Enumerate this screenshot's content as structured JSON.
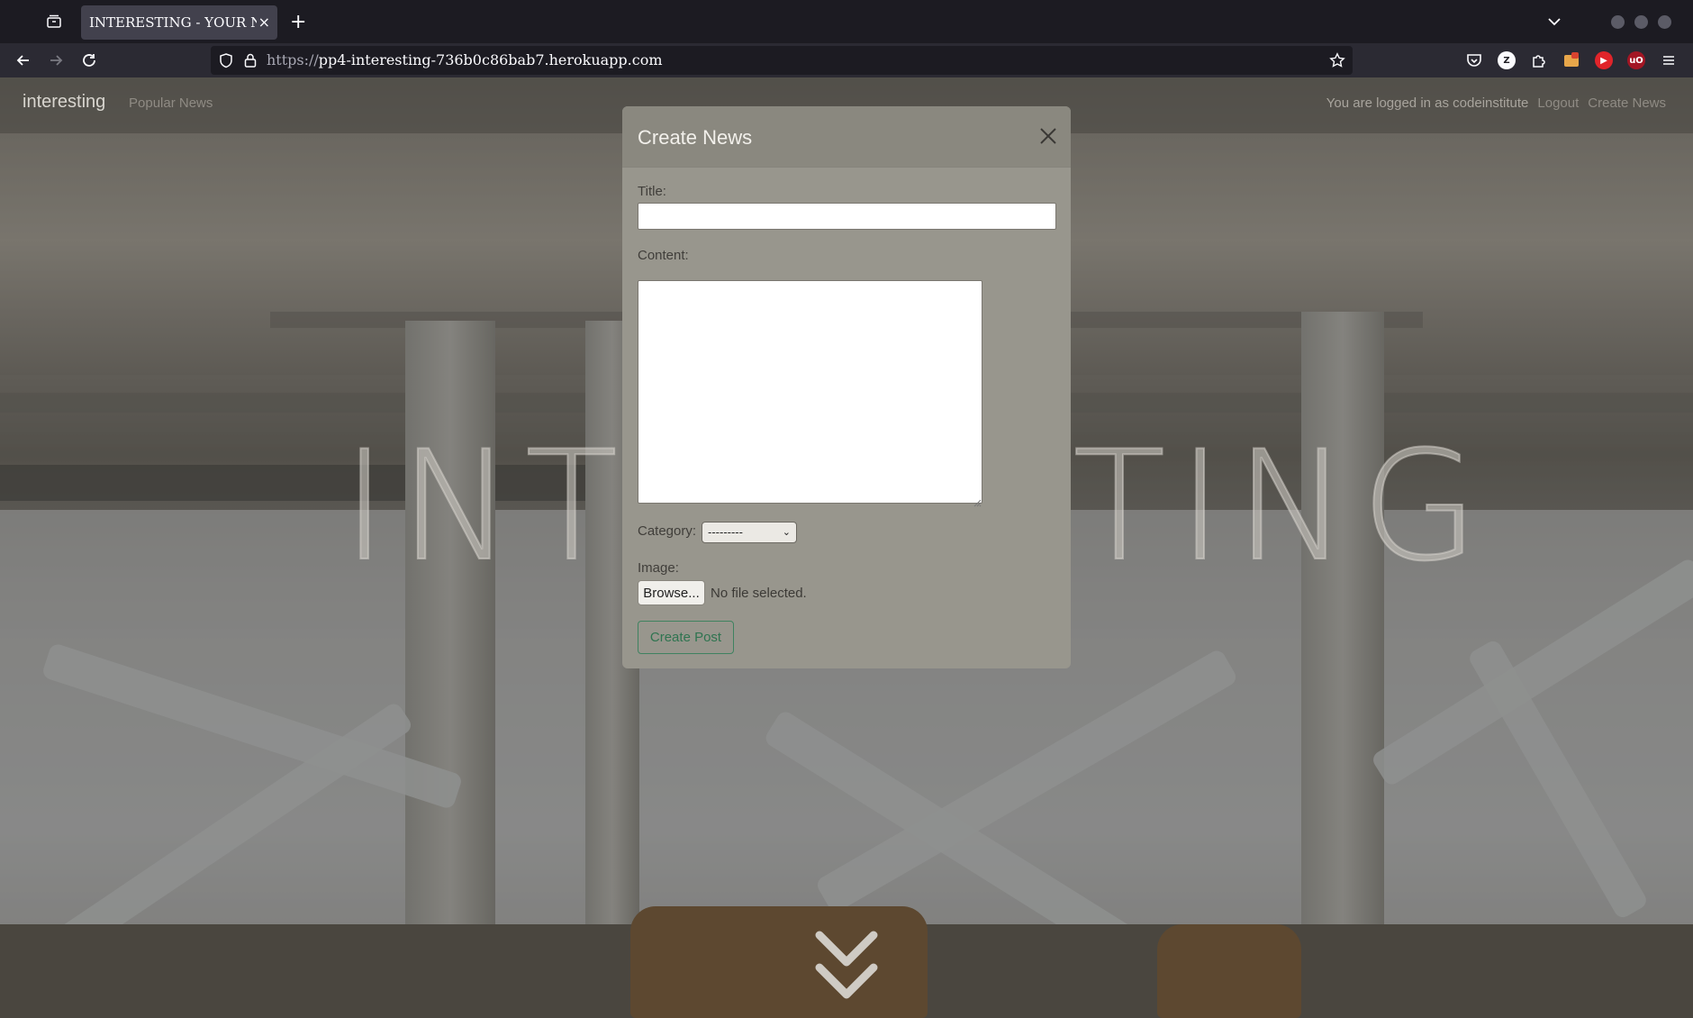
{
  "browser": {
    "tab_title": "INTERESTING - YOUR NEWS",
    "tab_close": "×",
    "new_tab": "+",
    "url_scheme": "https://",
    "url_host": "pp4-interesting-736b0c86bab7.herokuapp.com",
    "extensions": [
      {
        "name": "zotero",
        "glyph": "Z",
        "color": "#fbfbfe"
      },
      {
        "name": "youtube",
        "glyph": "▶",
        "color": "#e0242a"
      },
      {
        "name": "ublock",
        "glyph": "uO",
        "color": "#a31624"
      }
    ]
  },
  "site": {
    "brand": "interesting",
    "nav_popular": "Popular News",
    "logged_in_text": "You are logged in as codeinstitute",
    "logout": "Logout",
    "create_news": "Create News",
    "hero_text": "INTERESTING"
  },
  "modal": {
    "title": "Create News",
    "title_label": "Title:",
    "title_value": "",
    "content_label": "Content:",
    "content_value": "",
    "category_label": "Category:",
    "category_selected": "---------",
    "image_label": "Image:",
    "browse_label": "Browse...",
    "file_status": "No file selected.",
    "submit_label": "Create Post"
  },
  "colors": {
    "modal_bg": "#98968d",
    "submit_accent": "#2f7450"
  }
}
